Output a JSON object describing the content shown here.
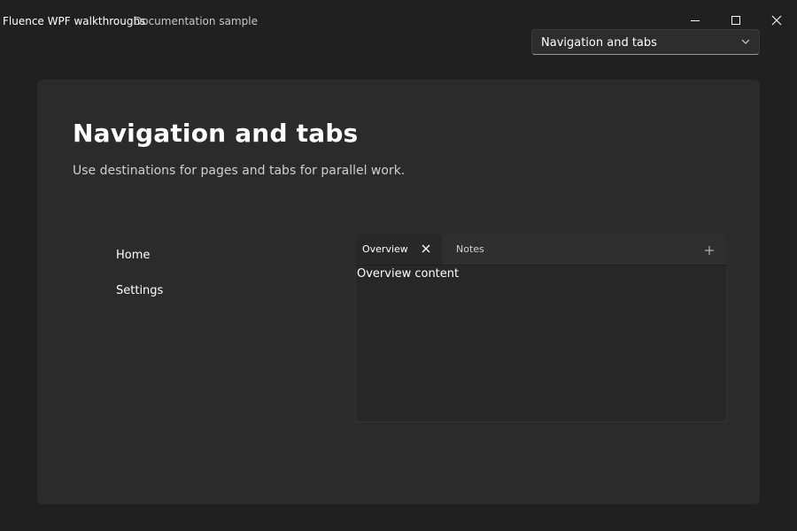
{
  "window": {
    "title": "Fluence WPF walkthroughs",
    "subtitle": "Documentation sample"
  },
  "titlebar": {
    "minimize_icon": "minimize-icon",
    "maximize_icon": "maximize-icon",
    "close_icon": "close-icon"
  },
  "page_selector": {
    "value": "Navigation and tabs",
    "icon": "chevron-down-icon"
  },
  "page": {
    "title": "Navigation and tabs",
    "description": "Use destinations for pages and tabs for parallel work."
  },
  "navigation": {
    "items": [
      {
        "label": "Home"
      },
      {
        "label": "Settings"
      }
    ]
  },
  "tabs": {
    "items": [
      {
        "label": "Overview",
        "selected": true,
        "closable": true
      },
      {
        "label": "Notes",
        "selected": false,
        "closable": false
      }
    ],
    "add_icon": "plus-icon",
    "content": "Overview content"
  },
  "colors": {
    "background": "#202020",
    "card": "#2b2b2b",
    "text": "#ffffff",
    "muted_text": "#cfcfcf"
  }
}
